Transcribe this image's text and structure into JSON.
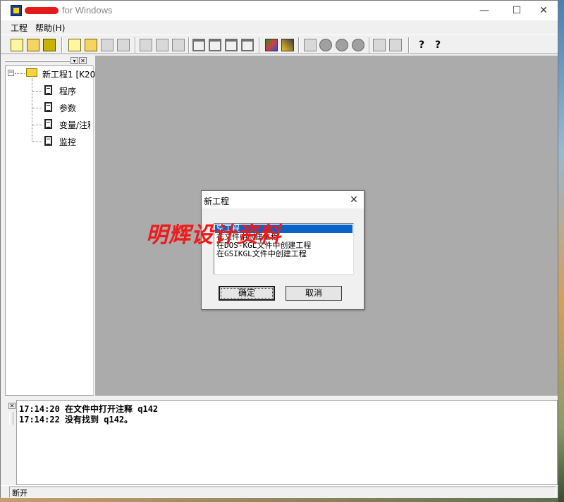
{
  "window": {
    "title": "for Windows",
    "controls": {
      "minimize": "—",
      "maximize": "☐",
      "close": "✕"
    }
  },
  "menu": [
    {
      "label": "工程"
    },
    {
      "label": "帮助(H)"
    }
  ],
  "toolbar": {
    "icons": [
      "new-project-icon",
      "open-project-icon",
      "save-project-icon",
      "new-file-icon",
      "open-file-icon",
      "save-file-icon",
      "print-icon",
      "cut-icon",
      "copy-icon",
      "paste-icon",
      "frame-1-icon",
      "frame-2-icon",
      "frame-3-icon",
      "frame-4-icon",
      "color-palette-icon",
      "pen-icon",
      "run-icon",
      "stop-icon",
      "step-icon",
      "monitor-icon",
      "download-icon",
      "upload-icon",
      "help-icon",
      "context-help-icon"
    ],
    "help_glyph": "?",
    "context_help_glyph": "?"
  },
  "tree": {
    "expand_glyph": "−",
    "root_label": "新工程1 [K20",
    "children": [
      {
        "label": "程序"
      },
      {
        "label": "参数"
      },
      {
        "label": "变量/注释"
      },
      {
        "label": "监控"
      }
    ],
    "pane_buttons": {
      "dropdown": "▾",
      "close": "✕"
    }
  },
  "dialog": {
    "title": "新工程",
    "close": "✕",
    "options": [
      {
        "label": "空工程",
        "selected": true
      },
      {
        "label": "在文件中创建工程",
        "selected": false
      },
      {
        "label": "在DOS-KGL文件中创建工程",
        "selected": false
      },
      {
        "label": "在GSIKGL文件中创建工程",
        "selected": false
      }
    ],
    "ok_label": "确定",
    "cancel_label": "取消"
  },
  "watermark": "明辉设计资料",
  "output": {
    "close": "✕",
    "lines": [
      "17:14:20 在文件中打开注释 q142",
      "17:14:22 没有找到 q142。"
    ]
  },
  "status": {
    "text": "断开"
  },
  "colors": {
    "selection": "#0a64c8",
    "mdi_background": "#ababab",
    "watermark": "#ee1a1a",
    "title_redaction": "#e51a1a"
  }
}
